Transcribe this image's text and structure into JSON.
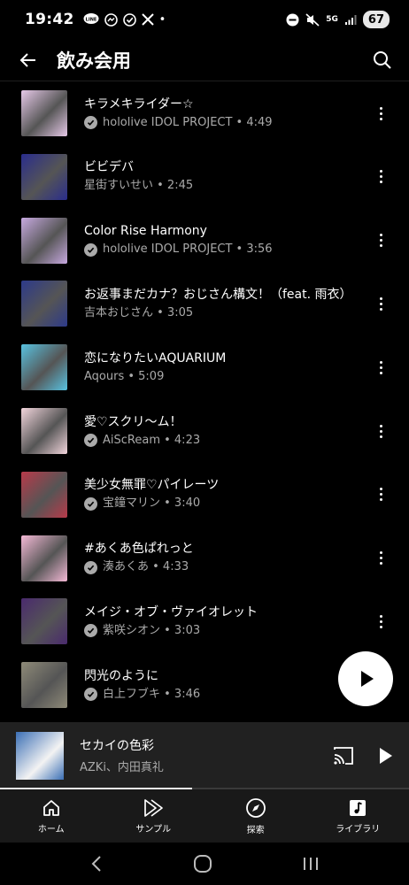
{
  "status_bar": {
    "time": "19:42",
    "left_icons": [
      "line-icon",
      "messenger-icon",
      "check-circle-icon",
      "x-icon"
    ],
    "dot": "•",
    "network": "5G",
    "battery": "67"
  },
  "header": {
    "title": "飲み会用",
    "back_icon": "arrow-left-icon",
    "search_icon": "search-icon"
  },
  "tracks": [
    {
      "title": "キラメキライダー☆",
      "subtitle": "hololive IDOL PROJECT • 4:49",
      "verified": true,
      "thumb_color": "#e6c9e8"
    },
    {
      "title": "ビビデバ",
      "subtitle": "星街すいせい • 2:45",
      "verified": false,
      "thumb_color": "#2a2d8c"
    },
    {
      "title": "Color Rise Harmony",
      "subtitle": "hololive IDOL PROJECT • 3:56",
      "verified": true,
      "thumb_color": "#c7a9e0"
    },
    {
      "title": "お返事まだカナ？おじさん構文！（feat. 雨衣）",
      "subtitle": "吉本おじさん • 3:05",
      "verified": false,
      "thumb_color": "#2d3a8a"
    },
    {
      "title": "恋になりたいAQUARIUM",
      "subtitle": "Aqours • 5:09",
      "verified": false,
      "thumb_color": "#58c2e0"
    },
    {
      "title": "愛♡スクリ～ム！",
      "subtitle": "AiScReam • 4:23",
      "verified": true,
      "thumb_color": "#f2d5dc"
    },
    {
      "title": "美少女無罪♡パイレーツ",
      "subtitle": "宝鐘マリン • 3:40",
      "verified": true,
      "thumb_color": "#b83a4a"
    },
    {
      "title": "#あくあ色ぱれっと",
      "subtitle": "湊あくあ • 4:33",
      "verified": true,
      "thumb_color": "#f4b9d6"
    },
    {
      "title": "メイジ・オブ・ヴァイオレット",
      "subtitle": "紫咲シオン • 3:03",
      "verified": true,
      "thumb_color": "#4a2a6e"
    },
    {
      "title": "閃光のように",
      "subtitle": "白上フブキ • 3:46",
      "verified": true,
      "thumb_color": "#8e8a78"
    }
  ],
  "fab": {
    "icon": "play-icon"
  },
  "mini_player": {
    "title": "セカイの色彩",
    "artist": "AZKi、内田真礼",
    "thumb_color": "#3b6fb5",
    "progress": 0.47
  },
  "bottom_nav": [
    {
      "label": "ホーム",
      "icon": "home-icon"
    },
    {
      "label": "サンプル",
      "icon": "samples-icon"
    },
    {
      "label": "探索",
      "icon": "compass-icon"
    },
    {
      "label": "ライブラリ",
      "icon": "library-icon"
    }
  ],
  "colors": {
    "background": "#000000",
    "mini_player_bg": "#212121",
    "bottom_nav_bg": "#191919",
    "secondary_text": "#aaaaaa"
  }
}
